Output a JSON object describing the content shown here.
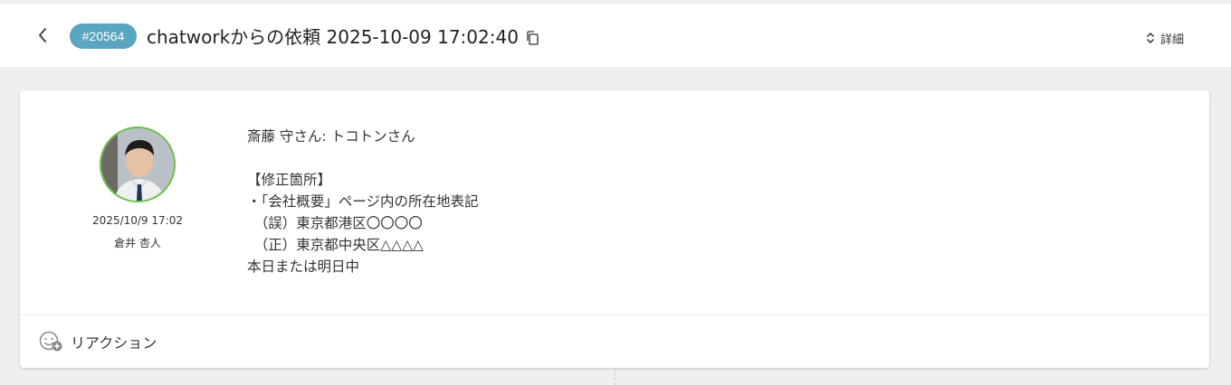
{
  "header": {
    "ticket_number": "#20564",
    "title": "chatworkからの依頼 2025-10-09 17:02:40",
    "details_label": "詳細"
  },
  "message": {
    "timestamp": "2025/10/9 17:02",
    "author": "倉井 杏人",
    "lines": [
      "斎藤 守さん: トコトンさん",
      "",
      "【修正箇所】",
      "・「会社概要」ページ内の所在地表記",
      "　（誤）東京都港区〇〇〇〇",
      "　（正）東京都中央区△△△△",
      "本日または明日中"
    ]
  },
  "footer": {
    "reaction_label": "リアクション"
  },
  "colors": {
    "badge": "#5aa5bf",
    "avatar_ring": "#6cbf4a",
    "background": "#eef0f0"
  },
  "icons": {
    "back": "chevron-left-icon",
    "copy": "copy-icon",
    "details": "chevron-up-down-icon",
    "reaction": "add-reaction-icon"
  }
}
